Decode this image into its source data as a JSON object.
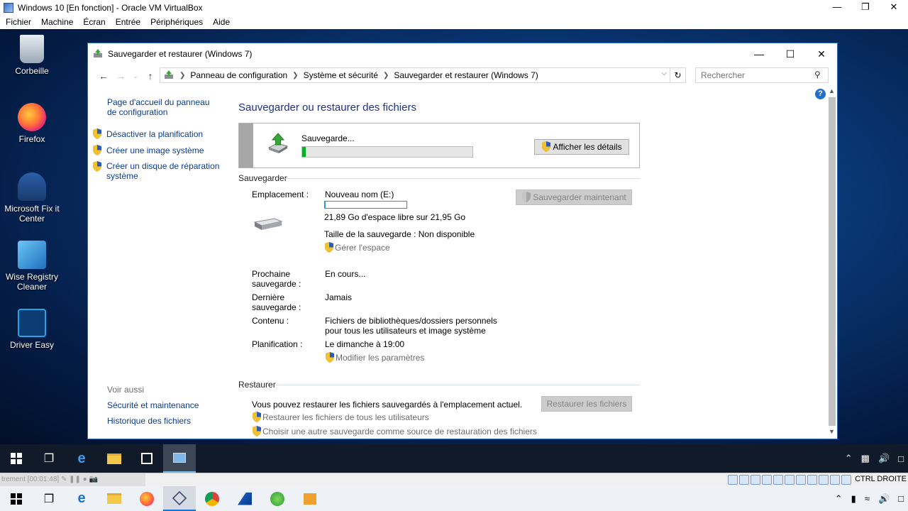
{
  "vbox": {
    "title": "Windows 10 [En fonction] - Oracle VM VirtualBox",
    "menu": [
      "Fichier",
      "Machine",
      "Écran",
      "Entrée",
      "Périphériques",
      "Aide"
    ],
    "status_recording": "trement [00:01:48]",
    "host_key": "CTRL DROITE"
  },
  "desktop_icons": [
    {
      "label": "Corbeille",
      "icon": "recycle-bin-icon"
    },
    {
      "label": "Firefox",
      "icon": "firefox-icon"
    },
    {
      "label": "Microsoft Fix it Center",
      "icon": "fix-it-icon"
    },
    {
      "label": "Wise Registry Cleaner",
      "icon": "registry-cleaner-icon"
    },
    {
      "label": "Driver Easy",
      "icon": "driver-easy-icon"
    }
  ],
  "window": {
    "title": "Sauvegarder et restaurer (Windows 7)",
    "breadcrumbs": [
      "Panneau de configuration",
      "Système et sécurité",
      "Sauvegarder et restaurer (Windows 7)"
    ],
    "search_placeholder": "Rechercher"
  },
  "left_pane": {
    "home_link": "Page d'accueil du panneau de configuration",
    "tasks": [
      "Désactiver la planification",
      "Créer une image système",
      "Créer un disque de réparation système"
    ],
    "see_also": "Voir aussi",
    "see_also_links": [
      "Sécurité et maintenance",
      "Historique des fichiers"
    ]
  },
  "main": {
    "heading": "Sauvegarder ou restaurer des fichiers",
    "progress_label": "Sauvegarde...",
    "progress_fraction": 0.02,
    "details_button": "Afficher les détails",
    "backup_section": "Sauvegarder",
    "backup_now_button": "Sauvegarder maintenant",
    "location_label": "Emplacement :",
    "location_value": "Nouveau nom (E:)",
    "free_space": "21,89 Go d'espace libre sur 21,95 Go",
    "backup_size": "Taille de la sauvegarde : Non disponible",
    "manage_space": "Gérer l'espace",
    "next_backup_label": "Prochaine sauvegarde :",
    "next_backup_value": "En cours...",
    "last_backup_label": "Dernière sauvegarde :",
    "last_backup_value": "Jamais",
    "content_label": "Contenu :",
    "content_value": "Fichiers de bibliothèques/dossiers personnels pour tous les utilisateurs et image système",
    "schedule_label": "Planification :",
    "schedule_value": "Le dimanche à 19:00",
    "modify_settings": "Modifier les paramètres",
    "restore_section": "Restaurer",
    "restore_text": "Vous pouvez restaurer les fichiers sauvegardés à l'emplacement actuel.",
    "restore_button": "Restaurer les fichiers",
    "restore_all_users": "Restaurer les fichiers de tous les utilisateurs",
    "choose_other_backup": "Choisir une autre sauvegarde comme source de restauration des fichiers"
  },
  "colors": {
    "link": "#0b3c8c",
    "heading": "#1e3287",
    "progress": "#06b025",
    "disabled_text": "#6d6d6d"
  }
}
